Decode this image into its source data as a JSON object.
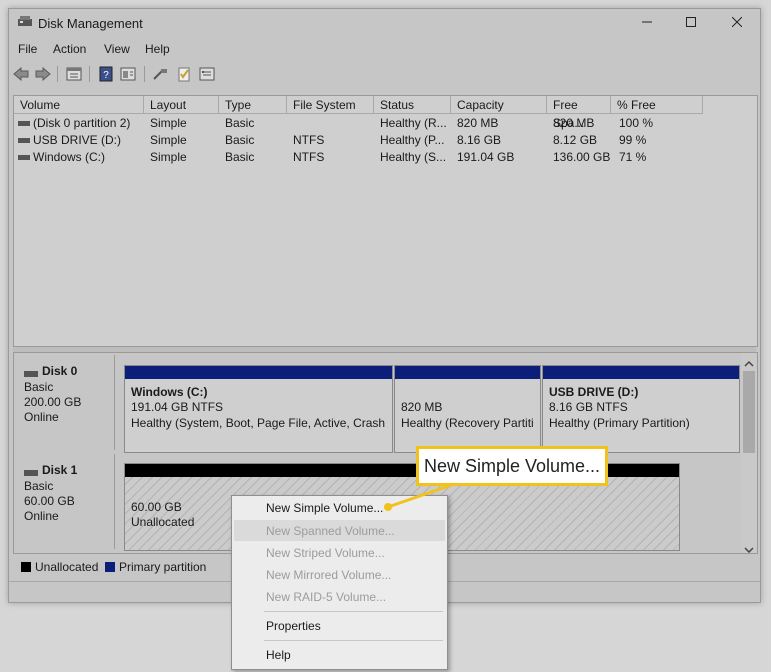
{
  "window": {
    "title": "Disk Management"
  },
  "menu": {
    "items": [
      "File",
      "Action",
      "View",
      "Help"
    ]
  },
  "toolbar": {
    "icons": [
      "back-arrow-icon",
      "forward-arrow-icon",
      "properties-panel-icon",
      "help-icon",
      "console-icon",
      "connect-icon",
      "checklist-icon",
      "settings-panel-icon"
    ]
  },
  "volume_list": {
    "columns": [
      "Volume",
      "Layout",
      "Type",
      "File System",
      "Status",
      "Capacity",
      "Free Spa...",
      "% Free"
    ],
    "rows": [
      {
        "volume": "(Disk 0 partition 2)",
        "layout": "Simple",
        "type": "Basic",
        "fs": "",
        "status": "Healthy (R...",
        "capacity": "820 MB",
        "free": "820 MB",
        "pct": "100 %"
      },
      {
        "volume": "USB DRIVE (D:)",
        "layout": "Simple",
        "type": "Basic",
        "fs": "NTFS",
        "status": "Healthy (P...",
        "capacity": "8.16 GB",
        "free": "8.12 GB",
        "pct": "99 %"
      },
      {
        "volume": "Windows (C:)",
        "layout": "Simple",
        "type": "Basic",
        "fs": "NTFS",
        "status": "Healthy (S...",
        "capacity": "191.04 GB",
        "free": "136.00 GB",
        "pct": "71 %"
      }
    ]
  },
  "disks": {
    "disk0": {
      "name": "Disk 0",
      "type": "Basic",
      "size": "200.00 GB",
      "state": "Online",
      "vol_windows": {
        "name": "Windows  (C:)",
        "size": "191.04 GB NTFS",
        "status": "Healthy (System, Boot, Page File, Active, Crash D"
      },
      "vol_recovery": {
        "size": "820 MB",
        "status": "Healthy (Recovery Partiti"
      },
      "vol_usb": {
        "name": "USB DRIVE  (D:)",
        "size": "8.16 GB NTFS",
        "status": "Healthy (Primary Partition)"
      }
    },
    "disk1": {
      "name": "Disk 1",
      "type": "Basic",
      "size": "60.00 GB",
      "state": "Online",
      "unalloc_size": "60.00 GB",
      "unalloc_label": "Unallocated"
    }
  },
  "legend": {
    "unallocated": "Unallocated",
    "primary": "Primary partition"
  },
  "context_menu": {
    "new_simple": "New Simple Volume...",
    "new_spanned": "New Spanned Volume...",
    "new_striped": "New Striped Volume...",
    "new_mirrored": "New Mirrored Volume...",
    "new_raid5": "New RAID-5 Volume...",
    "properties": "Properties",
    "help": "Help"
  },
  "callout": {
    "text": "New Simple Volume..."
  },
  "colors": {
    "primary_partition": "#0b1e7a",
    "unallocated": "#000000",
    "highlight": "#f1c21b"
  }
}
